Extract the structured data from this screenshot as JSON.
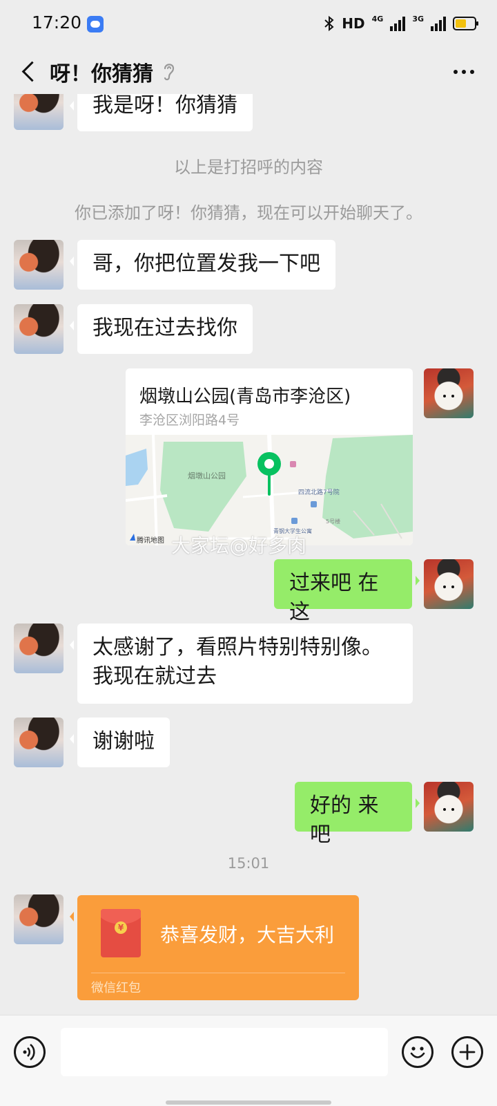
{
  "status_bar": {
    "time": "17:20",
    "bluetooth_icon": "bluetooth-icon",
    "hd_label": "HD",
    "network_1": "4G",
    "network_2": "3G",
    "battery_color": "#f2c10f"
  },
  "header": {
    "title": "呀！你猜猜",
    "back_icon": "chevron-left-icon",
    "ear_icon": "ear-icon",
    "more_icon": "more-icon"
  },
  "messages": [
    {
      "type": "text",
      "side": "left",
      "text": "我是呀！你猜猜"
    },
    {
      "type": "system",
      "text": "以上是打招呼的内容"
    },
    {
      "type": "system",
      "text": "你已添加了呀！你猜猜，现在可以开始聊天了。"
    },
    {
      "type": "text",
      "side": "left",
      "text": "哥，你把位置发我一下吧"
    },
    {
      "type": "text",
      "side": "left",
      "text": "我现在过去找你"
    },
    {
      "type": "location",
      "side": "right",
      "name": "烟墩山公园(青岛市李沧区)",
      "address": "李沧区浏阳路4号",
      "map_labels": [
        "烟墩山公园",
        "四流北路7号院",
        "青钢大学生公寓",
        "5号楼"
      ],
      "map_provider": "腾讯地图",
      "watermark": "大家坛@好多肉"
    },
    {
      "type": "text",
      "side": "right",
      "text": "过来吧 在这"
    },
    {
      "type": "text",
      "side": "left",
      "text": "太感谢了，看照片特别特别像。我现在就过去"
    },
    {
      "type": "text",
      "side": "left",
      "text": "谢谢啦"
    },
    {
      "type": "text",
      "side": "right",
      "text": "好的 来吧"
    },
    {
      "type": "time",
      "text": "15:01"
    },
    {
      "type": "red_packet",
      "side": "left",
      "title": "恭喜发财，大吉大利",
      "label": "微信红包"
    }
  ],
  "input_bar": {
    "voice_icon": "voice-icon",
    "placeholder": "",
    "emoji_icon": "emoji-icon",
    "plus_icon": "plus-icon"
  },
  "colors": {
    "background": "#ededed",
    "bubble_self": "#95ec69",
    "bubble_other": "#ffffff",
    "red_packet": "#fa9d3b",
    "map_pin": "#07c160"
  }
}
